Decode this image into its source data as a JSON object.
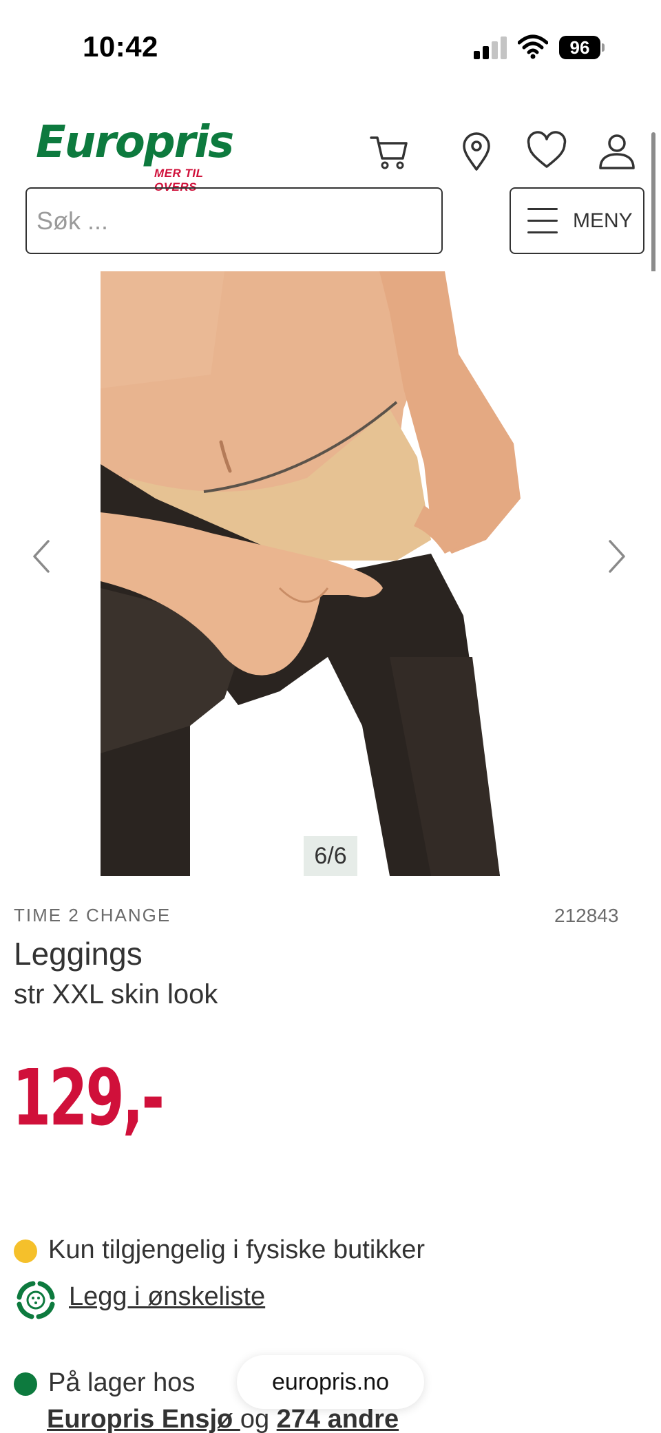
{
  "status_bar": {
    "time": "10:42",
    "battery": "96"
  },
  "header": {
    "logo_text": "Europris",
    "logo_tagline": "MER TIL OVERS",
    "search_placeholder": "Søk ...",
    "menu_label": "MENY",
    "icons": [
      "cart-icon",
      "location-icon",
      "heart-icon",
      "user-icon"
    ]
  },
  "gallery": {
    "counter": "6/6"
  },
  "product": {
    "brand": "TIME 2 CHANGE",
    "sku": "212843",
    "title": "Leggings",
    "subtitle": "str XXL skin look",
    "price": "129,-"
  },
  "availability": {
    "physical_only": "Kun tilgjengelig i fysiske butikker",
    "wishlist_link": "Legg i ønskeliste",
    "in_stock_prefix": "På lager hos",
    "store_name": "Europris Ensjø ",
    "store_connector": "og ",
    "other_stores": "274 andre"
  },
  "browser": {
    "url": "europris.no"
  },
  "colors": {
    "brand_green": "#0d7a3e",
    "brand_red": "#d0103a",
    "status_yellow": "#f5c02b",
    "status_green": "#0d7a3e"
  }
}
